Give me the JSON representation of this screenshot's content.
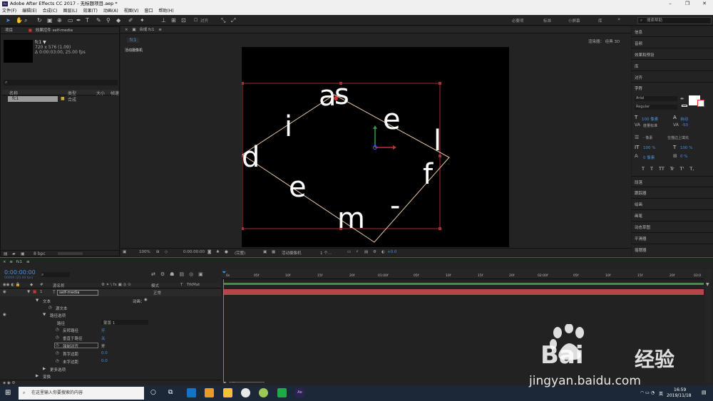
{
  "window": {
    "title": "Adobe After Effects CC 2017 - 无标题项目.aep *",
    "logo": "Ae"
  },
  "menu": [
    "文件(F)",
    "编辑(E)",
    "合成(C)",
    "图层(L)",
    "效果(T)",
    "动画(A)",
    "视图(V)",
    "窗口",
    "帮助(H)"
  ],
  "toolbar": {
    "align_label": "对齐",
    "workspaces": [
      "必要项",
      "标准",
      "小屏幕",
      "库"
    ],
    "search_placeholder": "搜索帮助"
  },
  "project": {
    "tab_project": "项目",
    "tab_effects": "效果控件 self-media",
    "comp_name": "fc1 ▼",
    "comp_info1": "720 x 576 (1.09)",
    "comp_info2": "Δ 0:00:03:00, 25.00 fps",
    "col_name": "名称",
    "col_type": "类型",
    "col_size": "大小",
    "col_fps": "帧速",
    "item_name": "fc1",
    "item_type": "合成",
    "bpc": "8 bpc"
  },
  "comp": {
    "tab": "合成 fc1",
    "subtab": "fc1",
    "camera_label": "活动摄像机",
    "renderer_label": "渲染器：",
    "renderer_value": "经典 3D",
    "zoom": "100%",
    "timecode": "0:00:00:00",
    "quality": "(完整)",
    "camera_select": "活动摄像机",
    "views": "1 个...",
    "exposure": "+0.0"
  },
  "viewer_letters": [
    {
      "ch": "a",
      "name": "letter-a"
    },
    {
      "ch": "s",
      "name": "letter-s"
    },
    {
      "ch": "i",
      "name": "letter-i"
    },
    {
      "ch": "e",
      "name": "letter-e-top"
    },
    {
      "ch": "l",
      "name": "letter-l"
    },
    {
      "ch": "d",
      "name": "letter-d"
    },
    {
      "ch": "f",
      "name": "letter-f"
    },
    {
      "ch": "e",
      "name": "letter-e-bottom"
    },
    {
      "ch": "m",
      "name": "letter-m"
    },
    {
      "ch": "-",
      "name": "letter-dash"
    }
  ],
  "right_panel": {
    "items": [
      "信息",
      "音频",
      "效果和预设",
      "库",
      "对齐",
      "字符",
      "段落",
      "跟踪器",
      "绘画",
      "画笔",
      "动态草图",
      "平滑器",
      "摇摆器"
    ],
    "char_font": "Arial",
    "char_style": "Regular",
    "char_size": "100 像素",
    "char_leading": "自动",
    "char_kerning": "度量标准",
    "char_tracking": "-50",
    "char_stroke": "- 像素",
    "char_stroke_opt": "在描边上填充",
    "scale_v": "100 %",
    "scale_h": "100 %",
    "baseline": "0 像素",
    "tsume": "0 %",
    "styles": [
      "T",
      "T",
      "TT",
      "Tr",
      "T'",
      "T,"
    ]
  },
  "timeline": {
    "tab": "fc1",
    "timecode": "0:00:00:00",
    "timecode_sub": "00000 (25.00 fps)",
    "col_layer_name": "源名称",
    "col_mode": "模式",
    "col_t": "T",
    "col_trkmat": "TrkMat",
    "layer_num": "1",
    "layer_name": "self-media",
    "layer_mode": "正常",
    "rows": [
      {
        "label": "文本",
        "name": "prop-text"
      },
      {
        "label": "源文本",
        "name": "prop-source-text"
      },
      {
        "label": "路径选项",
        "name": "prop-path-options"
      },
      {
        "label": "路径",
        "name": "prop-path"
      },
      {
        "label": "反转路径",
        "name": "prop-reverse-path"
      },
      {
        "label": "垂直于路径",
        "name": "prop-perpendicular"
      },
      {
        "label": "强制对齐",
        "name": "prop-force-align"
      },
      {
        "label": "首字边距",
        "name": "prop-first-margin"
      },
      {
        "label": "末字边距",
        "name": "prop-last-margin"
      },
      {
        "label": "更多选项",
        "name": "prop-more-options"
      },
      {
        "label": "变换",
        "name": "prop-transform"
      }
    ],
    "animate_label": "动画：",
    "path_value": "蒙版 1",
    "values": {
      "reverse": "开",
      "perpendicular": "关",
      "force_align": "开",
      "first_margin": "0.0",
      "last_margin": "0.0"
    },
    "ruler": [
      "0s",
      "05f",
      "10f",
      "15f",
      "20f",
      "01:00f",
      "05f",
      "10f",
      "15f",
      "20f",
      "02:00f",
      "05f",
      "10f",
      "15f",
      "20f",
      "03:0"
    ]
  },
  "taskbar": {
    "search_placeholder": "在这里输入你要搜索的内容",
    "time": "16:59",
    "date": "2019/11/18",
    "lang": "英"
  },
  "watermark": {
    "brand": "Bai",
    "brand2": "经验",
    "url": "jingyan.baidu.com"
  }
}
